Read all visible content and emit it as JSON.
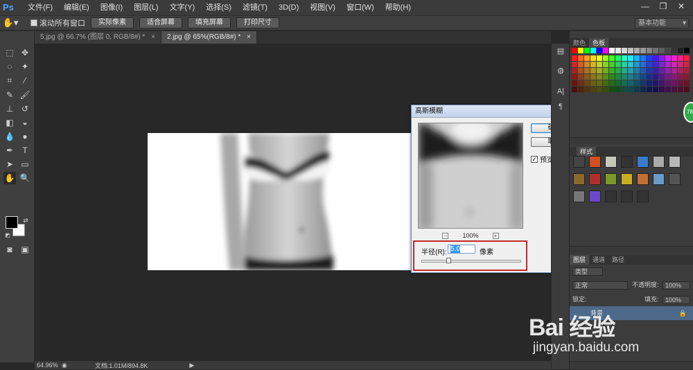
{
  "app": {
    "logo": "Ps"
  },
  "menu": [
    "文件(F)",
    "编辑(E)",
    "图像(I)",
    "图层(L)",
    "文字(Y)",
    "选择(S)",
    "滤镜(T)",
    "3D(D)",
    "视图(V)",
    "窗口(W)",
    "帮助(H)"
  ],
  "window_controls": [
    "—",
    "❐",
    "✕"
  ],
  "options_bar": {
    "scroll_all_label": "滚动所有窗口",
    "buttons": [
      "实际像素",
      "适合屏幕",
      "填充屏幕",
      "打印尺寸"
    ],
    "workspace": "基本功能"
  },
  "tabs": [
    {
      "label": "5.jpg @ 66.7% (图层 0, RGB/8#) *",
      "close": "×"
    },
    {
      "label": "2.jpg @ 65%(RGB/8#) *",
      "close": "×"
    }
  ],
  "status": {
    "zoom": "64.96%",
    "doc": "文档:1.01M/894.8K"
  },
  "dialog": {
    "title": "高斯模糊",
    "close": "✕",
    "ok": "确定",
    "cancel": "取消",
    "preview_label": "预览(P)",
    "preview_checked": true,
    "zoom_minus": "−",
    "zoom_plus": "+",
    "zoom_level": "100%",
    "radius_label": "半径(R):",
    "radius_value": "5.0",
    "radius_unit": "像素",
    "slider_fraction": 0.27
  },
  "panels": {
    "swatches_tabs": [
      "颜色",
      "色板"
    ],
    "styles_tabs": [
      "",
      "样式"
    ],
    "layers_tabs": [
      "图层",
      "通道",
      "路径"
    ],
    "layers": {
      "kind": "类型",
      "blend": "正常",
      "opacity_label": "不透明度:",
      "opacity": "100%",
      "lock_label": "锁定:",
      "fill_label": "填充:",
      "fill": "100%",
      "layer_name": "背景"
    }
  },
  "watermark": {
    "main": "Bai 经验",
    "sub": "jingyan.baidu.com"
  },
  "badge": "78"
}
